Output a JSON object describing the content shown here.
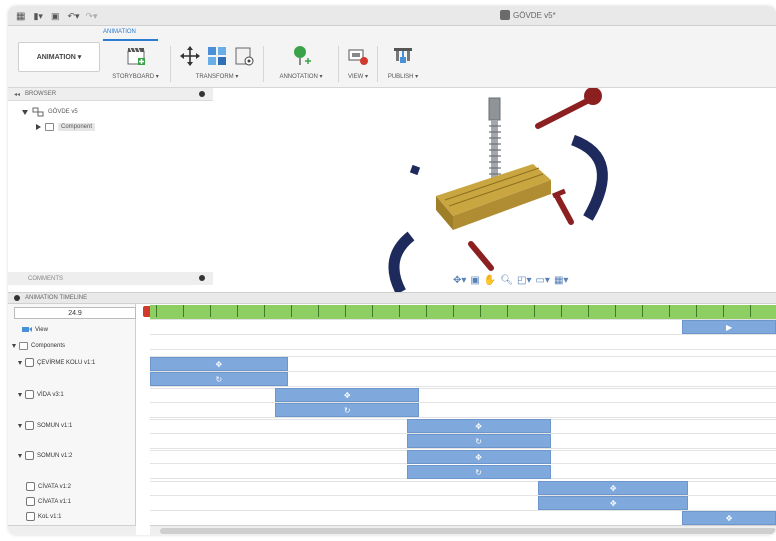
{
  "titlebar": {
    "document_title": "GÖVDE v5*"
  },
  "ribbon": {
    "workspace_tab": "ANIMATION",
    "workspace_button": "ANIMATION ▾",
    "groups": [
      {
        "id": "storyboard",
        "label": "STORYBOARD ▾"
      },
      {
        "id": "transform",
        "label": "TRANSFORM ▾"
      },
      {
        "id": "annotation",
        "label": "ANNOTATION ▾"
      },
      {
        "id": "view",
        "label": "VIEW ▾"
      },
      {
        "id": "publish",
        "label": "PUBLISH ▾"
      }
    ]
  },
  "browser": {
    "header": "BROWSER",
    "root": "GÖVDE v5",
    "child": "Component"
  },
  "comments": {
    "header": "COMMENTS"
  },
  "timeline": {
    "header": "ANIMATION TIMELINE",
    "time": "24.9",
    "tracks": [
      {
        "label": "View"
      },
      {
        "label": "Components"
      },
      {
        "label": "ÇEVİRME KOLU v1:1"
      },
      {
        "label": "VİDA v3:1"
      },
      {
        "label": "SOMUN v1:1"
      },
      {
        "label": "SOMUN v1:2"
      },
      {
        "label": "CİVATA v1:2"
      },
      {
        "label": "CİVATA v1:1"
      },
      {
        "label": "KoL v1:1"
      }
    ],
    "bars": [
      {
        "track": "View",
        "start_frac": 0.85,
        "end_frac": 1.0,
        "icon": "▶"
      },
      {
        "track": "ÇEVİRME KOLU v1:1",
        "start_frac": 0.0,
        "end_frac": 0.22,
        "icon": "✥"
      },
      {
        "track": "ÇEVİRME KOLU v1:1",
        "start_frac": 0.0,
        "end_frac": 0.22,
        "icon": "↻"
      },
      {
        "track": "VİDA v3:1",
        "start_frac": 0.2,
        "end_frac": 0.43,
        "icon": "✥"
      },
      {
        "track": "VİDA v3:1",
        "start_frac": 0.2,
        "end_frac": 0.43,
        "icon": "↻"
      },
      {
        "track": "SOMUN v1:1",
        "start_frac": 0.41,
        "end_frac": 0.64,
        "icon": "✥"
      },
      {
        "track": "SOMUN v1:1",
        "start_frac": 0.41,
        "end_frac": 0.64,
        "icon": "↻"
      },
      {
        "track": "SOMUN v1:2",
        "start_frac": 0.41,
        "end_frac": 0.64,
        "icon": "✥"
      },
      {
        "track": "SOMUN v1:2",
        "start_frac": 0.41,
        "end_frac": 0.64,
        "icon": "↻"
      },
      {
        "track": "CİVATA v1:2",
        "start_frac": 0.62,
        "end_frac": 0.86,
        "icon": "✥"
      },
      {
        "track": "CİVATA v1:1",
        "start_frac": 0.62,
        "end_frac": 0.86,
        "icon": "✥"
      },
      {
        "track": "KoL v1:1",
        "start_frac": 0.85,
        "end_frac": 1.0,
        "icon": "✥"
      }
    ]
  },
  "colors": {
    "accent": "#2b7bd0",
    "timeline_ruler": "#8ecf63",
    "bar": "#7fa8dd",
    "time_marker": "#d13a2c",
    "part_yellow": "#c9a640",
    "part_red": "#8c2020",
    "part_navy": "#1e2a5c",
    "part_steel": "#8f9499"
  }
}
